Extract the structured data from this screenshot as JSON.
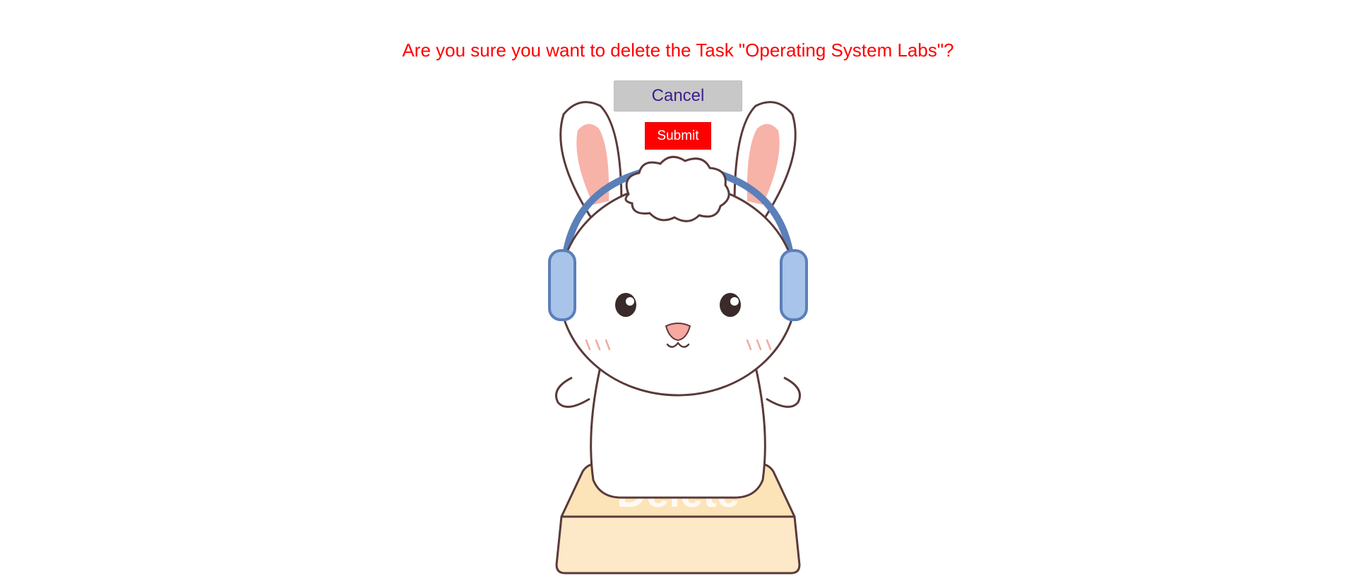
{
  "dialog": {
    "prompt": "Are you sure you want to delete the Task \"Operating System Labs\"?",
    "cancel_label": "Cancel",
    "submit_label": "Submit"
  },
  "illustration": {
    "subject": "bunny-with-headphones-on-delete-key",
    "key_label": "Delete"
  },
  "colors": {
    "prompt_text": "#ff0000",
    "cancel_bg": "#c8c8c8",
    "cancel_text": "#3b1f8c",
    "submit_bg": "#ff0000",
    "submit_text": "#ffffff",
    "headphones": "#5b7fb8",
    "key": "#fde3b8"
  }
}
